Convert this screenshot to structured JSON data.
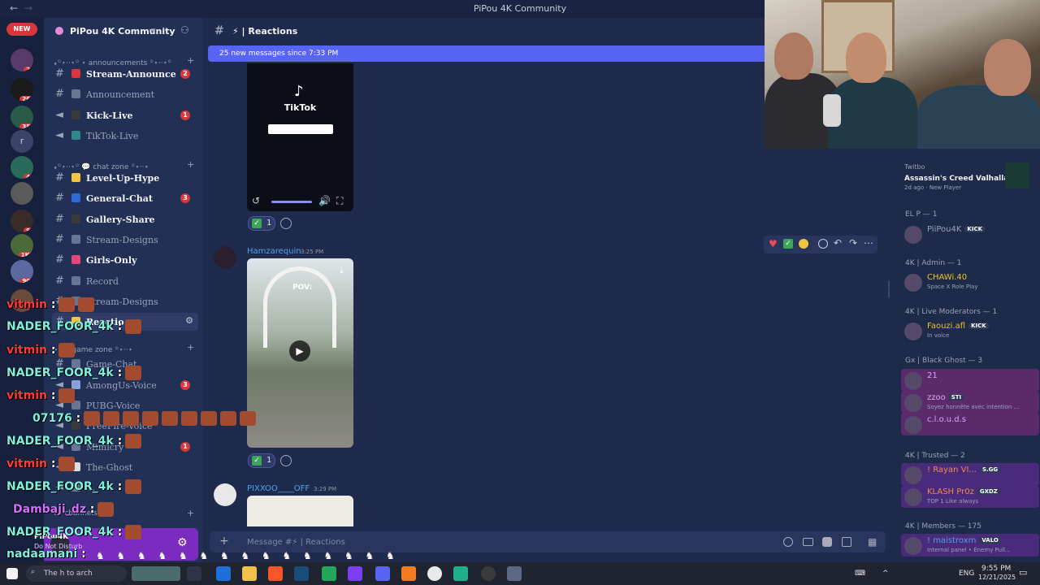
{
  "window": {
    "title": "PiPou 4K Community",
    "back_icon": "arrow-left-icon",
    "fwd_icon": "arrow-right-icon"
  },
  "rail": {
    "new_label": "NEW",
    "servers": [
      {
        "badge": "25"
      },
      {
        "badge": "260"
      },
      {
        "badge": "357"
      },
      {
        "letter": "r"
      },
      {
        "badge": "45"
      },
      {
        "badge": ""
      },
      {
        "badge": "95"
      },
      {
        "badge": "1K+"
      },
      {
        "badge": "901"
      },
      {
        "badge": "6"
      }
    ]
  },
  "server": {
    "name": "PiPou 4K Community",
    "chevron": "▾"
  },
  "categories": {
    "announcements": "꘎꙳⋆⋅⋅⋆꙳ ⋆ announcements ꙳⋆⋅⋅⋆꙳",
    "chat_zone": "꘎꙳⋆⋅⋅⋆꙳ 💬 chat zone ꙳⋆⋅⋅⋆",
    "game_zone": "⋆ 🎮 game zone ꙳⋆⋅⋅⋆",
    "voice": "ce channels ⋅⋆"
  },
  "channels": [
    {
      "name": "Stream-Announce",
      "count": "2",
      "unread": true,
      "type": "text"
    },
    {
      "name": "Announcement",
      "count": "",
      "unread": false,
      "type": "text"
    },
    {
      "name": "Kick-Live",
      "count": "1",
      "unread": true,
      "type": "voice"
    },
    {
      "name": "TikTok-Live",
      "count": "",
      "unread": false,
      "type": "voice"
    },
    {
      "name": "Level-Up-Hype",
      "count": "",
      "unread": true,
      "type": "text"
    },
    {
      "name": "General-Chat",
      "count": "3",
      "unread": true,
      "type": "text"
    },
    {
      "name": "Gallery-Share",
      "count": "",
      "unread": true,
      "type": "text"
    },
    {
      "name": "Stream-Designs",
      "count": "",
      "unread": false,
      "type": "text"
    },
    {
      "name": "Girls-Only",
      "count": "",
      "unread": true,
      "type": "text"
    },
    {
      "name": "Record",
      "count": "",
      "unread": false,
      "type": "text"
    },
    {
      "name": "Stream-Designs",
      "count": "",
      "unread": false,
      "type": "text"
    },
    {
      "name": "Reactio",
      "count": "",
      "unread": true,
      "type": "text"
    },
    {
      "name": "Game-Chat",
      "count": "",
      "unread": false,
      "type": "text"
    },
    {
      "name": "AmongUs-Voice",
      "count": "3",
      "unread": false,
      "type": "voice"
    },
    {
      "name": "PUBG-Voice",
      "count": "",
      "unread": false,
      "type": "voice"
    },
    {
      "name": "FreeFire-Voice",
      "count": "",
      "unread": false,
      "type": "voice"
    },
    {
      "name": "Mimicry",
      "count": "1",
      "unread": false,
      "type": "voice"
    },
    {
      "name": "The-Ghost",
      "count": "",
      "unread": false,
      "type": "voice"
    },
    {
      "name": "...",
      "count": "",
      "unread": false,
      "type": "voice"
    }
  ],
  "user_panel": {
    "name": "PiPou4K",
    "status": "Do Not Disturb"
  },
  "overlay": [
    {
      "user": "vitmin",
      "color": "rd"
    },
    {
      "user": "NADER_FOOR_4k",
      "color": "cy"
    },
    {
      "user": "vitmin",
      "color": "rd"
    },
    {
      "user": "NADER_FOOR_4k",
      "color": "cy"
    },
    {
      "user": "vitmin",
      "color": "rd"
    },
    {
      "user": "07176",
      "color": "cy"
    },
    {
      "user": "NADER_FOOR_4k",
      "color": "cy"
    },
    {
      "user": "vitmin",
      "color": "rd"
    },
    {
      "user": "NADER_FOOR_4k",
      "color": "cy"
    },
    {
      "user": "Dambaji_dz",
      "color": "pk"
    },
    {
      "user": "NADER_FOOR_4k",
      "color": "cy"
    },
    {
      "user": "nadaamani",
      "color": "cy"
    }
  ],
  "header": {
    "hash": "#",
    "channel": "⚡ | Reactions"
  },
  "new_messages": "25 new messages since 7:33 PM",
  "messages": [
    {
      "tiktok_label": "TikTok",
      "reaction_count": "1"
    },
    {
      "user": "Hamzarequin",
      "time": "3:25 PM",
      "caption": "POV:",
      "reaction_count": "1"
    },
    {
      "user": "PIXXOO____OFF",
      "time": "3:29 PM"
    }
  ],
  "hover_actions": [
    "heart-icon",
    "check-icon",
    "thinking-icon",
    "add-reaction-icon",
    "reply-icon",
    "forward-icon",
    "more-icon"
  ],
  "composer": {
    "placeholder": "Message #⚡ | Reactions",
    "plus": "+"
  },
  "activity": {
    "user": "Twitbo",
    "game": "Assassin's Creed Valhalla",
    "time": "2d ago",
    "status": "New Player"
  },
  "members": {
    "groups": [
      {
        "title": "EL P — 1",
        "members": [
          {
            "name": "PiiPou4K",
            "tag": "KICK",
            "sub": "",
            "color": "#9aa2b6"
          }
        ]
      },
      {
        "title": "4K | Admin — 1",
        "members": [
          {
            "name": "CHAWi.40",
            "tag": "",
            "sub": "Space X Role Play",
            "color": "#f0c419"
          }
        ]
      },
      {
        "title": "4K | Live Moderators — 1",
        "members": [
          {
            "name": "Faouzi.afl",
            "tag": "KICK",
            "sub": "In voice",
            "color": "#f0c419"
          }
        ]
      },
      {
        "title": "Gx | Black Ghost — 3",
        "members": [
          {
            "name": "21",
            "tag": "",
            "sub": "",
            "color": "#d9a6ff"
          },
          {
            "name": "zzoo",
            "tag": "STI",
            "sub": "Soyez honnête avec intention ...",
            "color": "#d9a6ff"
          },
          {
            "name": "c.l.o.u.d.s",
            "tag": "",
            "sub": "",
            "color": "#d9a6ff"
          }
        ]
      },
      {
        "title": "4K | Trusted — 2",
        "members": [
          {
            "name": "! Rayan VI...",
            "tag": "S.GG",
            "sub": "",
            "color": "#f08a4a"
          },
          {
            "name": "KLASH Pr0z",
            "tag": "GXDZ",
            "sub": "TOP 1 Like always",
            "color": "#f08a4a"
          }
        ]
      },
      {
        "title": "4K | Members — 175",
        "members": [
          {
            "name": "! maistroxm",
            "tag": "VALO",
            "sub": "Internal panel • Enemy Pull...",
            "color": "#4aa3f0"
          }
        ]
      }
    ]
  },
  "taskbar": {
    "search_placeholder": "The h  to  arch",
    "lang": "ENG",
    "time": "9:55 PM",
    "date": "12/21/2025"
  },
  "colors": {
    "accent": "#5865f2",
    "danger": "#da373c",
    "bg": "#1f2b4c"
  }
}
